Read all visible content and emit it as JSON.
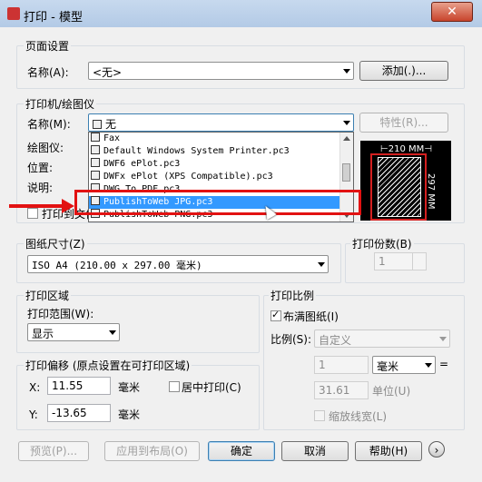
{
  "window": {
    "title": "打印 - 模型",
    "close_label": "✕"
  },
  "page_setup": {
    "group_label": "页面设置",
    "name_label": "名称(A):",
    "name_value": "<无>",
    "add_button": "添加(.)..."
  },
  "printer": {
    "group_label": "打印机/绘图仪",
    "name_label": "名称(M):",
    "name_value": "无",
    "properties_button": "特性(R)...",
    "plotter_label": "绘图仪:",
    "location_label": "位置:",
    "description_label": "说明:",
    "print_to_file_label": "打印到文件",
    "dropdown_items": [
      "Fax",
      "Default Windows System Printer.pc3",
      "DWF6 ePlot.pc3",
      "DWFx ePlot (XPS Compatible).pc3",
      "DWG To PDF.pc3",
      "PublishToWeb JPG.pc3",
      "PublishToWeb PNG.pc3"
    ],
    "selected_item": "PublishToWeb JPG.pc3",
    "preview_width": "210 MM",
    "preview_height": "297 MM"
  },
  "paper_size": {
    "group_label": "图纸尺寸(Z)",
    "value": "ISO A4 (210.00 x 297.00 毫米)"
  },
  "copies": {
    "group_label": "打印份数(B)",
    "value": "1"
  },
  "plot_area": {
    "group_label": "打印区域",
    "range_label": "打印范围(W):",
    "range_value": "显示"
  },
  "plot_offset": {
    "group_label": "打印偏移 (原点设置在可打印区域)",
    "x_label": "X:",
    "x_value": "11.55",
    "x_unit": "毫米",
    "y_label": "Y:",
    "y_value": "-13.65",
    "y_unit": "毫米",
    "center_label": "居中打印(C)"
  },
  "plot_scale": {
    "group_label": "打印比例",
    "fit_label": "布满图纸(I)",
    "scale_label": "比例(S):",
    "scale_value": "自定义",
    "value1": "1",
    "unit_value": "毫米",
    "equals": "=",
    "value2": "31.61",
    "unit_label": "单位(U)",
    "lineweight_label": "缩放线宽(L)"
  },
  "footer": {
    "preview_button": "预览(P)...",
    "apply_button": "应用到布局(O)",
    "ok_button": "确定",
    "cancel_button": "取消",
    "help_button": "帮助(H)",
    "more_button": "›"
  }
}
